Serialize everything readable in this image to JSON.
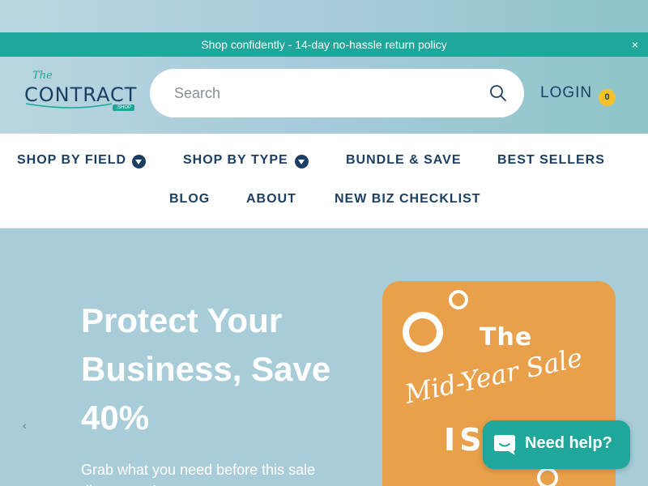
{
  "announcement": {
    "text": "Shop confidently - 14-day no-hassle return policy",
    "close_label": "×"
  },
  "logo": {
    "the": "The",
    "name": "CONTRACT",
    "tag": ".SHOP"
  },
  "search": {
    "placeholder": "Search",
    "icon": "search-icon"
  },
  "account": {
    "login_label": "LOGIN",
    "cart_count": "0"
  },
  "nav": {
    "row1": [
      {
        "label": "SHOP BY FIELD",
        "has_dropdown": true
      },
      {
        "label": "SHOP BY TYPE",
        "has_dropdown": true
      },
      {
        "label": "BUNDLE & SAVE",
        "has_dropdown": false
      },
      {
        "label": "BEST SELLERS",
        "has_dropdown": false
      }
    ],
    "row2": [
      {
        "label": "BLOG"
      },
      {
        "label": "ABOUT"
      },
      {
        "label": "NEW BIZ CHECKLIST"
      }
    ]
  },
  "hero": {
    "prev_arrow": "‹",
    "title": "Protect Your Business, Save 40%",
    "subtitle": "Grab what you need before this sale disappears!",
    "promo": {
      "the": "The",
      "script": "Mid-Year Sale",
      "is": "IS"
    }
  },
  "chat": {
    "label": "Need help?"
  },
  "colors": {
    "teal": "#1ea79a",
    "navy": "#1b3f63",
    "cart_badge": "#f5c22c",
    "hero_bg": "#a8cdd9",
    "promo_bg": "#e9a04a"
  }
}
